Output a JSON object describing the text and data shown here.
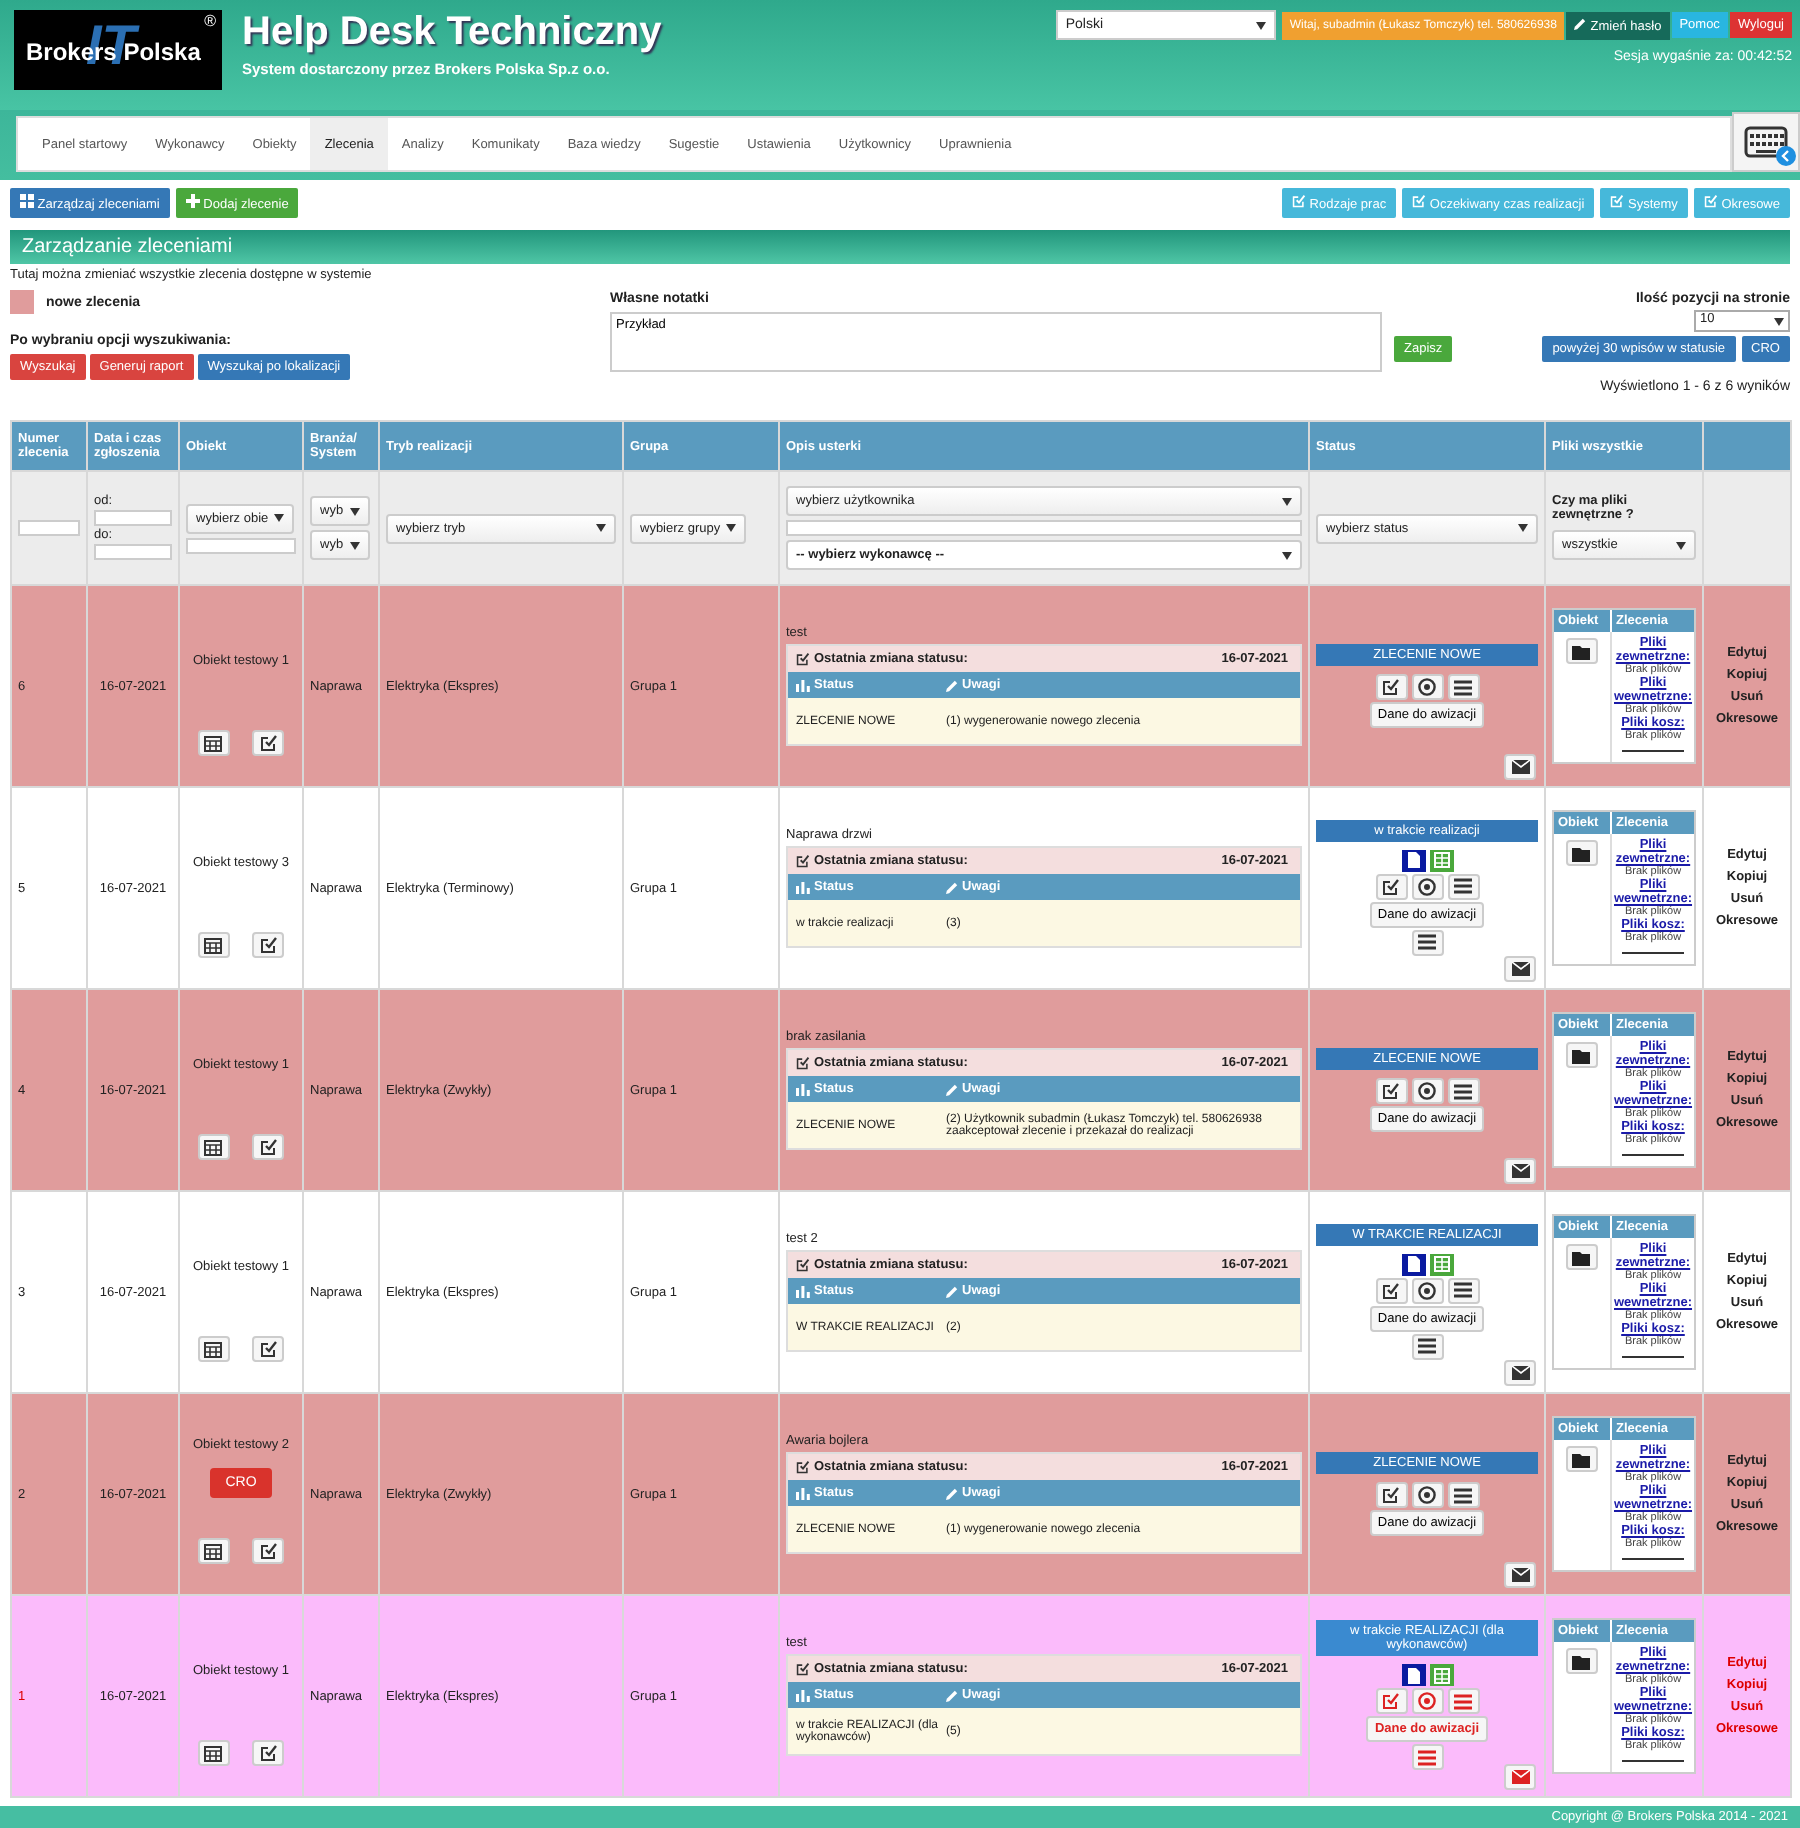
{
  "header": {
    "logo_text": "Brokers Polska",
    "logo_mark": "IT",
    "logo_reg": "®",
    "title": "Help Desk Techniczny",
    "subtitle": "System dostarczony przez Brokers Polska Sp.z o.o.",
    "language": "Polski",
    "user": "Witaj, subadmin (Łukasz Tomczyk) tel. 580626938",
    "change_password": "Zmień hasło",
    "help": "Pomoc",
    "logout": "Wyloguj",
    "session": "Sesja wygaśnie za: 00:42:52"
  },
  "nav": [
    {
      "label": "Panel startowy",
      "selected": false
    },
    {
      "label": "Wykonawcy",
      "selected": false
    },
    {
      "label": "Obiekty",
      "selected": false
    },
    {
      "label": "Zlecenia",
      "selected": true
    },
    {
      "label": "Analizy",
      "selected": false
    },
    {
      "label": "Komunikaty",
      "selected": false
    },
    {
      "label": "Baza wiedzy",
      "selected": false
    },
    {
      "label": "Sugestie",
      "selected": false
    },
    {
      "label": "Ustawienia",
      "selected": false
    },
    {
      "label": "Użytkownicy",
      "selected": false
    },
    {
      "label": "Uprawnienia",
      "selected": false
    }
  ],
  "toolbar": {
    "left": [
      "Zarządzaj zleceniami",
      "Dodaj zlecenie"
    ],
    "right": [
      "Rodzaje prac",
      "Oczekiwany czas realizacji",
      "Systemy",
      "Okresowe"
    ]
  },
  "panel": {
    "title": "Zarządzanie zleceniami",
    "description": "Tutaj można zmieniać wszystkie zlecenia dostępne w systemie",
    "legend": "nowe zlecenia",
    "search_label": "Po wybraniu opcji wyszukiwania:",
    "search_buttons": [
      "Wyszukaj",
      "Generuj raport",
      "Wyszukaj po lokalizacji"
    ],
    "notes_label": "Własne notatki",
    "notes_value": "Przykład",
    "save": "Zapisz",
    "per_page_label": "Ilość pozycji na stronie",
    "per_page": "10",
    "over30": "powyżej 30 wpisów w statusie",
    "cro": "CRO",
    "results": "Wyświetlono 1 - 6 z 6 wyników"
  },
  "table": {
    "columns": [
      "Numer zlecenia",
      "Data i czas zgłoszenia",
      "Obiekt",
      "Branża/ System",
      "Tryb realizacji",
      "Grupa",
      "Opis usterki",
      "Status",
      "Pliki wszystkie"
    ],
    "filters": {
      "from": "od:",
      "to": "do:",
      "object": "wybierz obie",
      "branch": "wyb",
      "system": "wyb",
      "mode": "wybierz tryb",
      "group": "wybierz grupy",
      "user": "wybierz użytkownika",
      "contractor": "-- wybierz wykonawcę --",
      "status": "wybierz status",
      "files_question": "Czy ma pliki zewnętrzne ?",
      "files": "wszystkie"
    },
    "rows": [
      {
        "number": "6",
        "date": "16-07-2021",
        "object": "Obiekt testowy 1",
        "branch": "Naprawa",
        "mode": "Elektryka (Ekspres)",
        "group": "Grupa 1",
        "title": "test",
        "change_label": "Ostatnia zmiana statusu:",
        "change_date": "16-07-2021",
        "status_head": "Status",
        "notes_head": "Uwagi",
        "status": "ZLECENIE NOWE",
        "notes": "(1) wygenerowanie nowego zlecenia",
        "status_button": "ZLECENIE NOWE",
        "kind": "new",
        "notify": "Dane do awizacji",
        "files_tabs": [
          "Obiekt",
          "Zlecenia"
        ],
        "files": [
          {
            "link": "Pliki zewnetrzne:",
            "note": "Brak plików"
          },
          {
            "link": "Pliki wewnetrzne:",
            "note": "Brak plików"
          },
          {
            "link": "Pliki kosz:",
            "note": "Brak plików"
          }
        ],
        "actions": [
          "Edytuj",
          "Kopiuj",
          "Usuń",
          "Okresowe"
        ]
      },
      {
        "number": "5",
        "date": "16-07-2021",
        "object": "Obiekt testowy 3",
        "branch": "Naprawa",
        "mode": "Elektryka (Terminowy)",
        "group": "Grupa 1",
        "title": "Naprawa drzwi",
        "change_label": "Ostatnia zmiana statusu:",
        "change_date": "16-07-2021",
        "status_head": "Status",
        "notes_head": "Uwagi",
        "status": "w trakcie realizacji",
        "notes": "(3)",
        "status_button": "w trakcie realizacji",
        "kind": "progress",
        "notify": "Dane do awizacji",
        "files_tabs": [
          "Obiekt",
          "Zlecenia"
        ],
        "files": [
          {
            "link": "Pliki zewnetrzne:",
            "note": "Brak plików"
          },
          {
            "link": "Pliki wewnetrzne:",
            "note": "Brak plików"
          },
          {
            "link": "Pliki kosz:",
            "note": "Brak plików"
          }
        ],
        "actions": [
          "Edytuj",
          "Kopiuj",
          "Usuń",
          "Okresowe"
        ]
      },
      {
        "number": "4",
        "date": "16-07-2021",
        "object": "Obiekt testowy 1",
        "branch": "Naprawa",
        "mode": "Elektryka (Zwykły)",
        "group": "Grupa 1",
        "title": "brak zasilania",
        "change_label": "Ostatnia zmiana statusu:",
        "change_date": "16-07-2021",
        "status_head": "Status",
        "notes_head": "Uwagi",
        "status": "ZLECENIE NOWE",
        "notes": "(2) Użytkownik subadmin (Łukasz Tomczyk) tel. 580626938 zaakceptował zlecenie i przekazał do realizacji",
        "status_button": "ZLECENIE NOWE",
        "kind": "new",
        "notify": "Dane do awizacji",
        "files_tabs": [
          "Obiekt",
          "Zlecenia"
        ],
        "files": [
          {
            "link": "Pliki zewnetrzne:",
            "note": "Brak plików"
          },
          {
            "link": "Pliki wewnetrzne:",
            "note": "Brak plików"
          },
          {
            "link": "Pliki kosz:",
            "note": "Brak plików"
          }
        ],
        "actions": [
          "Edytuj",
          "Kopiuj",
          "Usuń",
          "Okresowe"
        ]
      },
      {
        "number": "3",
        "date": "16-07-2021",
        "object": "Obiekt testowy 1",
        "branch": "Naprawa",
        "mode": "Elektryka (Ekspres)",
        "group": "Grupa 1",
        "title": "test 2",
        "change_label": "Ostatnia zmiana statusu:",
        "change_date": "16-07-2021",
        "status_head": "Status",
        "notes_head": "Uwagi",
        "status": "W TRAKCIE REALIZACJI",
        "notes": "(2)",
        "status_button": "W TRAKCIE REALIZACJI",
        "kind": "progress",
        "notify": "Dane do awizacji",
        "files_tabs": [
          "Obiekt",
          "Zlecenia"
        ],
        "files": [
          {
            "link": "Pliki zewnetrzne:",
            "note": "Brak plików"
          },
          {
            "link": "Pliki wewnetrzne:",
            "note": "Brak plików"
          },
          {
            "link": "Pliki kosz:",
            "note": "Brak plików"
          }
        ],
        "actions": [
          "Edytuj",
          "Kopiuj",
          "Usuń",
          "Okresowe"
        ]
      },
      {
        "number": "2",
        "date": "16-07-2021",
        "object": "Obiekt testowy 2",
        "cro": "CRO",
        "branch": "Naprawa",
        "mode": "Elektryka (Zwykły)",
        "group": "Grupa 1",
        "title": "Awaria bojlera",
        "change_label": "Ostatnia zmiana statusu:",
        "change_date": "16-07-2021",
        "status_head": "Status",
        "notes_head": "Uwagi",
        "status": "ZLECENIE NOWE",
        "notes": "(1) wygenerowanie nowego zlecenia",
        "status_button": "ZLECENIE NOWE",
        "kind": "new",
        "notify": "Dane do awizacji",
        "files_tabs": [
          "Obiekt",
          "Zlecenia"
        ],
        "files": [
          {
            "link": "Pliki zewnetrzne:",
            "note": "Brak plików"
          },
          {
            "link": "Pliki wewnetrzne:",
            "note": "Brak plików"
          },
          {
            "link": "Pliki kosz:",
            "note": "Brak plików"
          }
        ],
        "actions": [
          "Edytuj",
          "Kopiuj",
          "Usuń",
          "Okresowe"
        ]
      },
      {
        "number": "1",
        "date": "16-07-2021",
        "object": "Obiekt testowy 1",
        "branch": "Naprawa",
        "mode": "Elektryka (Ekspres)",
        "group": "Grupa 1",
        "title": "test",
        "change_label": "Ostatnia zmiana statusu:",
        "change_date": "16-07-2021",
        "status_head": "Status",
        "notes_head": "Uwagi",
        "status": "w trakcie REALIZACJI (dla wykonawców)",
        "notes": "(5)",
        "status_button": "w trakcie REALIZACJI (dla wykonawców)",
        "kind": "contractor",
        "notify": "Dane do awizacji",
        "files_tabs": [
          "Obiekt",
          "Zlecenia"
        ],
        "files": [
          {
            "link": "Pliki zewnetrzne:",
            "note": "Brak plików"
          },
          {
            "link": "Pliki wewnetrzne:",
            "note": "Brak plików"
          },
          {
            "link": "Pliki kosz:",
            "note": "Brak plików"
          }
        ],
        "actions": [
          "Edytuj",
          "Kopiuj",
          "Usuń",
          "Okresowe"
        ]
      }
    ]
  },
  "footer": "Copyright @ Brokers Polska 2014 - 2021"
}
